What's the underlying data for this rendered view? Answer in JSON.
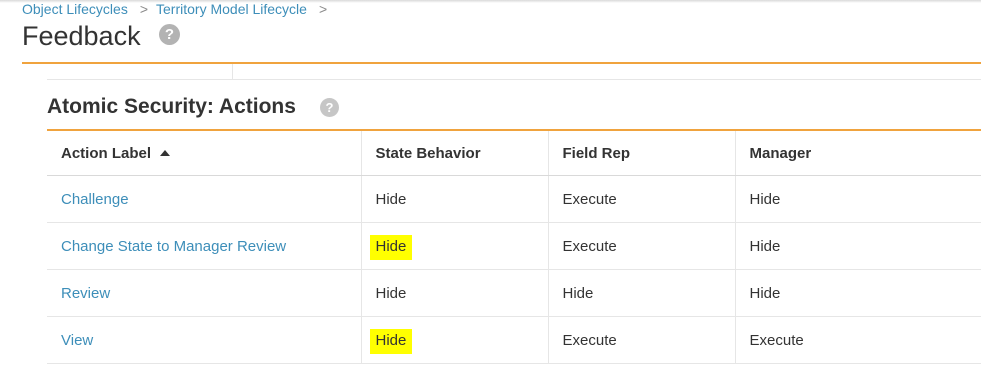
{
  "breadcrumb": {
    "items": [
      "Object Lifecycles",
      "Territory Model Lifecycle"
    ],
    "separator": ">"
  },
  "page": {
    "title": "Feedback",
    "help_glyph": "?"
  },
  "section": {
    "title": "Atomic Security: Actions",
    "help_glyph": "?"
  },
  "table": {
    "headers": [
      "Action Label",
      "State Behavior",
      "Field Rep",
      "Manager"
    ],
    "sort_icon": "sort-ascending-icon",
    "rows": [
      {
        "label": "Challenge",
        "state": "Hide",
        "field_rep": "Execute",
        "manager": "Hide",
        "state_highlighted": false
      },
      {
        "label": "Change State to Manager Review",
        "state": "Hide",
        "field_rep": "Execute",
        "manager": "Hide",
        "state_highlighted": true
      },
      {
        "label": "Review",
        "state": "Hide",
        "field_rep": "Hide",
        "manager": "Hide",
        "state_highlighted": false
      },
      {
        "label": "View",
        "state": "Hide",
        "field_rep": "Execute",
        "manager": "Execute",
        "state_highlighted": true
      }
    ]
  },
  "colors": {
    "accent": "#f0a33e",
    "link": "#3d8eb9",
    "highlight": "#ffff00"
  }
}
